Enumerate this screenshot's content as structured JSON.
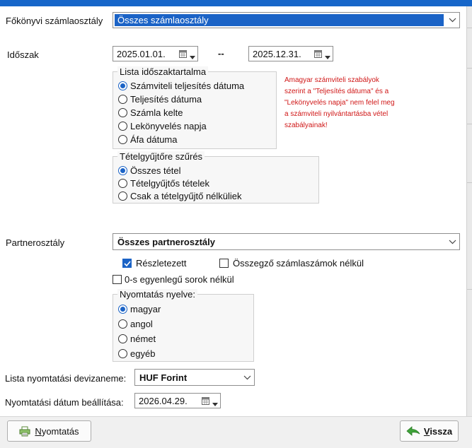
{
  "account_class": {
    "label": "Főkönyvi számlaosztály",
    "value": "Összes számlaosztály"
  },
  "period": {
    "label": "Időszak",
    "from": "2025.01.01.",
    "separator": "--",
    "to": "2025.12.31."
  },
  "list_content": {
    "legend": "Lista időszaktartalma",
    "options": [
      "Számviteli teljesítés dátuma",
      "Teljesítés dátuma",
      "Számla kelte",
      "Lekönyvelés napja",
      "Áfa dátuma"
    ],
    "selected": 0
  },
  "warning_lines": [
    "Amagyar számviteli szabályok",
    "szerint a \"Teljesítés dátuma\" és a",
    "\"Lekönyvelés napja\" nem felel meg",
    "a számviteli nyilvántartásba vétel",
    "szabályainak!"
  ],
  "collector_filter": {
    "legend": "Tételgyűjtőre szűrés",
    "options": [
      "Összes tétel",
      "Tételgyűjtős tételek",
      "Csak a tételgyűjtő nélküliek"
    ],
    "selected": 0
  },
  "partner_class": {
    "label": "Partnerosztály",
    "value": "Összes partnerosztály"
  },
  "checks": {
    "detailed": {
      "label": "Részletezett",
      "checked": true
    },
    "no_summary": {
      "label": "Összegző számlaszámok nélkül",
      "checked": false
    },
    "no_zero": {
      "label": "0-s egyenlegű sorok nélkül",
      "checked": false
    }
  },
  "print_language": {
    "legend": "Nyomtatás nyelve:",
    "options": [
      "magyar",
      "angol",
      "német",
      "egyéb"
    ],
    "selected": 0
  },
  "currency": {
    "label": "Lista nyomtatási devizaneme:",
    "value": "HUF  Forint"
  },
  "print_date": {
    "label": "Nyomtatási dátum beállítása:",
    "value": "2026.04.29."
  },
  "buttons": {
    "print": {
      "mnemonic": "N",
      "rest": "yomtatás"
    },
    "back": {
      "mnemonic": "V",
      "rest": "issza"
    }
  },
  "colors": {
    "accent": "#1b63c6",
    "warning": "#d01717",
    "title_bar": "#1666c9"
  },
  "icons": [
    "chevron-down-icon",
    "calendar-icon",
    "printer-icon",
    "back-arrow-icon"
  ]
}
